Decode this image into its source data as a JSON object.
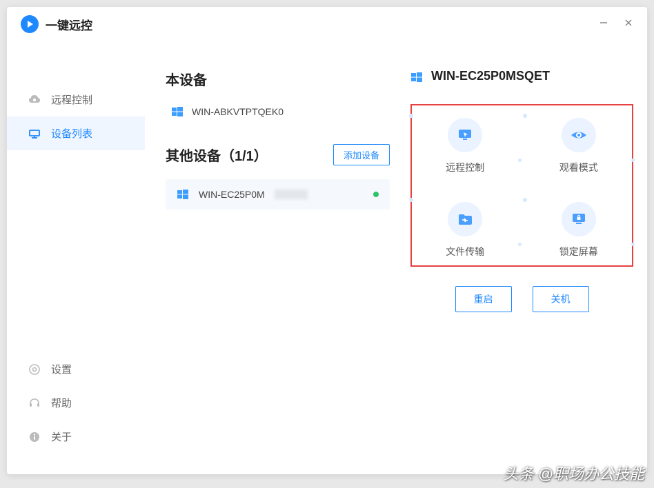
{
  "app": {
    "title": "一键远控"
  },
  "sidebar": {
    "remote": "远程控制",
    "devices": "设备列表",
    "settings": "设置",
    "help": "帮助",
    "about": "关于"
  },
  "local": {
    "heading": "本设备",
    "name": "WIN-ABKVTPTQEK0"
  },
  "other": {
    "heading": "其他设备（1/1）",
    "add_label": "添加设备",
    "items": [
      {
        "name": "WIN-EC25P0M",
        "online": true
      }
    ]
  },
  "detail": {
    "name": "WIN-EC25P0MSQET",
    "actions": {
      "remote_control": "远程控制",
      "watch_mode": "观看模式",
      "file_transfer": "文件传输",
      "lock_screen": "锁定屏幕"
    },
    "restart": "重启",
    "shutdown": "关机"
  },
  "watermark": "头条 @职场办公技能"
}
